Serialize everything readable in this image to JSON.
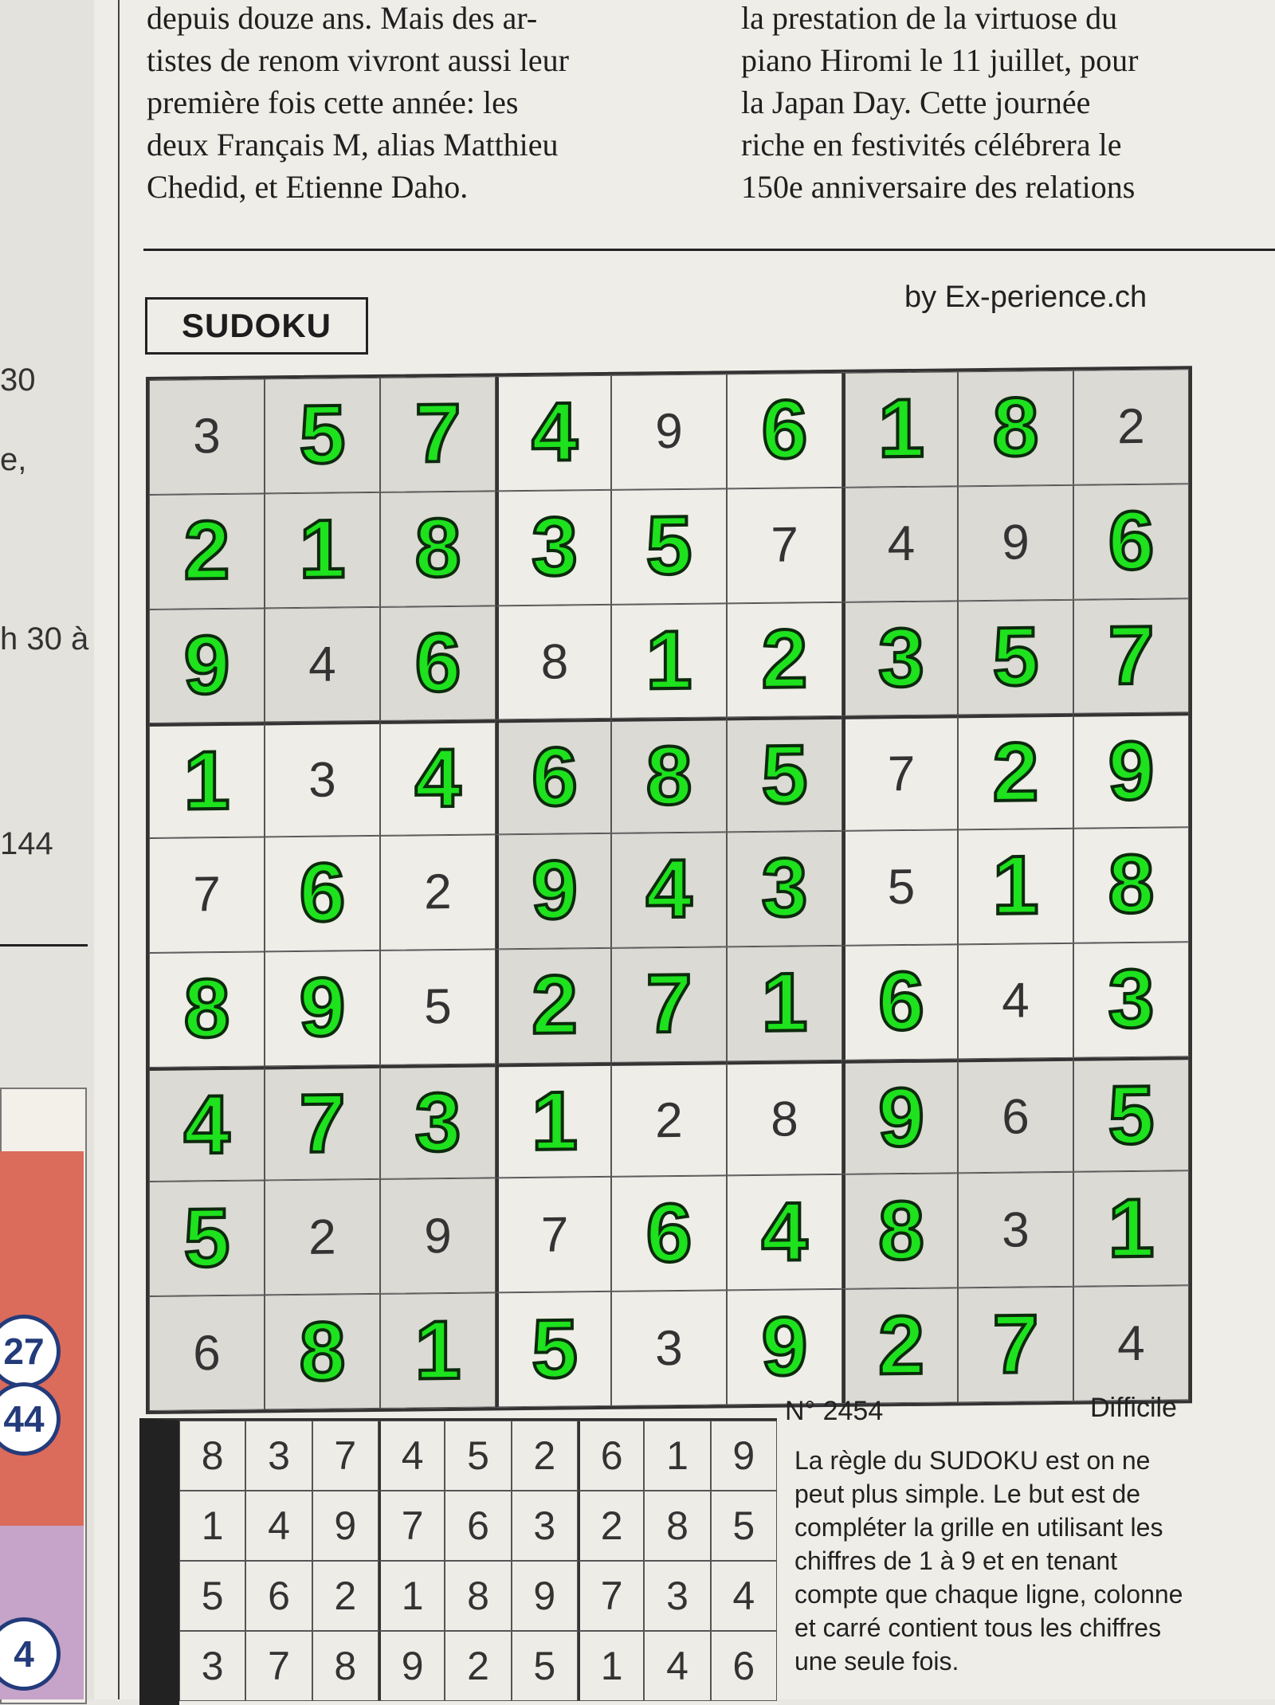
{
  "article": {
    "col1_lines": [
      "depuis douze ans. Mais des ar-",
      "tistes de renom vivront aussi leur",
      "première fois cette année: les",
      "deux Français M, alias Matthieu",
      "Chedid, et Etienne Daho."
    ],
    "col2_lines": [
      "la prestation de la virtuose du",
      "piano Hiromi le 11 juillet, pour",
      "la Japan Day. Cette journée",
      "riche en festivités célébrera le",
      "150e anniversaire des relations"
    ]
  },
  "left_fragments": [
    "30",
    "e,",
    "h 30 à",
    "144",
    "27",
    "44",
    "4"
  ],
  "sudoku": {
    "title": "SUDOKU",
    "byline": "by Ex-perience.ch",
    "number": "N° 2454",
    "level": "Difficile",
    "highlight_color": "#1de21d",
    "grid": [
      [
        [
          3,
          0
        ],
        [
          5,
          1
        ],
        [
          7,
          1
        ],
        [
          4,
          1
        ],
        [
          9,
          0
        ],
        [
          6,
          1
        ],
        [
          1,
          1
        ],
        [
          8,
          1
        ],
        [
          2,
          0
        ]
      ],
      [
        [
          2,
          1
        ],
        [
          1,
          1
        ],
        [
          8,
          1
        ],
        [
          3,
          1
        ],
        [
          5,
          1
        ],
        [
          7,
          0
        ],
        [
          4,
          0
        ],
        [
          9,
          0
        ],
        [
          6,
          1
        ]
      ],
      [
        [
          9,
          1
        ],
        [
          4,
          0
        ],
        [
          6,
          1
        ],
        [
          8,
          0
        ],
        [
          1,
          1
        ],
        [
          2,
          1
        ],
        [
          3,
          1
        ],
        [
          5,
          1
        ],
        [
          7,
          1
        ]
      ],
      [
        [
          1,
          1
        ],
        [
          3,
          0
        ],
        [
          4,
          1
        ],
        [
          6,
          1
        ],
        [
          8,
          1
        ],
        [
          5,
          1
        ],
        [
          7,
          0
        ],
        [
          2,
          1
        ],
        [
          9,
          1
        ]
      ],
      [
        [
          7,
          0
        ],
        [
          6,
          1
        ],
        [
          2,
          0
        ],
        [
          9,
          1
        ],
        [
          4,
          1
        ],
        [
          3,
          1
        ],
        [
          5,
          0
        ],
        [
          1,
          1
        ],
        [
          8,
          1
        ]
      ],
      [
        [
          8,
          1
        ],
        [
          9,
          1
        ],
        [
          5,
          0
        ],
        [
          2,
          1
        ],
        [
          7,
          1
        ],
        [
          1,
          1
        ],
        [
          6,
          1
        ],
        [
          4,
          0
        ],
        [
          3,
          1
        ]
      ],
      [
        [
          4,
          1
        ],
        [
          7,
          1
        ],
        [
          3,
          1
        ],
        [
          1,
          1
        ],
        [
          2,
          0
        ],
        [
          8,
          0
        ],
        [
          9,
          1
        ],
        [
          6,
          0
        ],
        [
          5,
          1
        ]
      ],
      [
        [
          5,
          1
        ],
        [
          2,
          0
        ],
        [
          9,
          0
        ],
        [
          7,
          0
        ],
        [
          6,
          1
        ],
        [
          4,
          1
        ],
        [
          8,
          1
        ],
        [
          3,
          0
        ],
        [
          1,
          1
        ]
      ],
      [
        [
          6,
          0
        ],
        [
          8,
          1
        ],
        [
          1,
          1
        ],
        [
          5,
          1
        ],
        [
          3,
          0
        ],
        [
          9,
          1
        ],
        [
          2,
          1
        ],
        [
          7,
          1
        ],
        [
          4,
          0
        ]
      ]
    ],
    "previous_solution": [
      [
        8,
        3,
        7,
        4,
        5,
        2,
        6,
        1,
        9
      ],
      [
        1,
        4,
        9,
        7,
        6,
        3,
        2,
        8,
        5
      ],
      [
        5,
        6,
        2,
        1,
        8,
        9,
        7,
        3,
        4
      ],
      [
        3,
        7,
        8,
        9,
        2,
        5,
        1,
        4,
        6
      ]
    ],
    "rules": "La règle du SUDOKU est on ne peut plus simple. Le but est de compléter la grille en utilisant les chiffres de 1 à 9 et en tenant compte que chaque ligne, colonne et carré contient tous les chiffres une seule fois."
  }
}
